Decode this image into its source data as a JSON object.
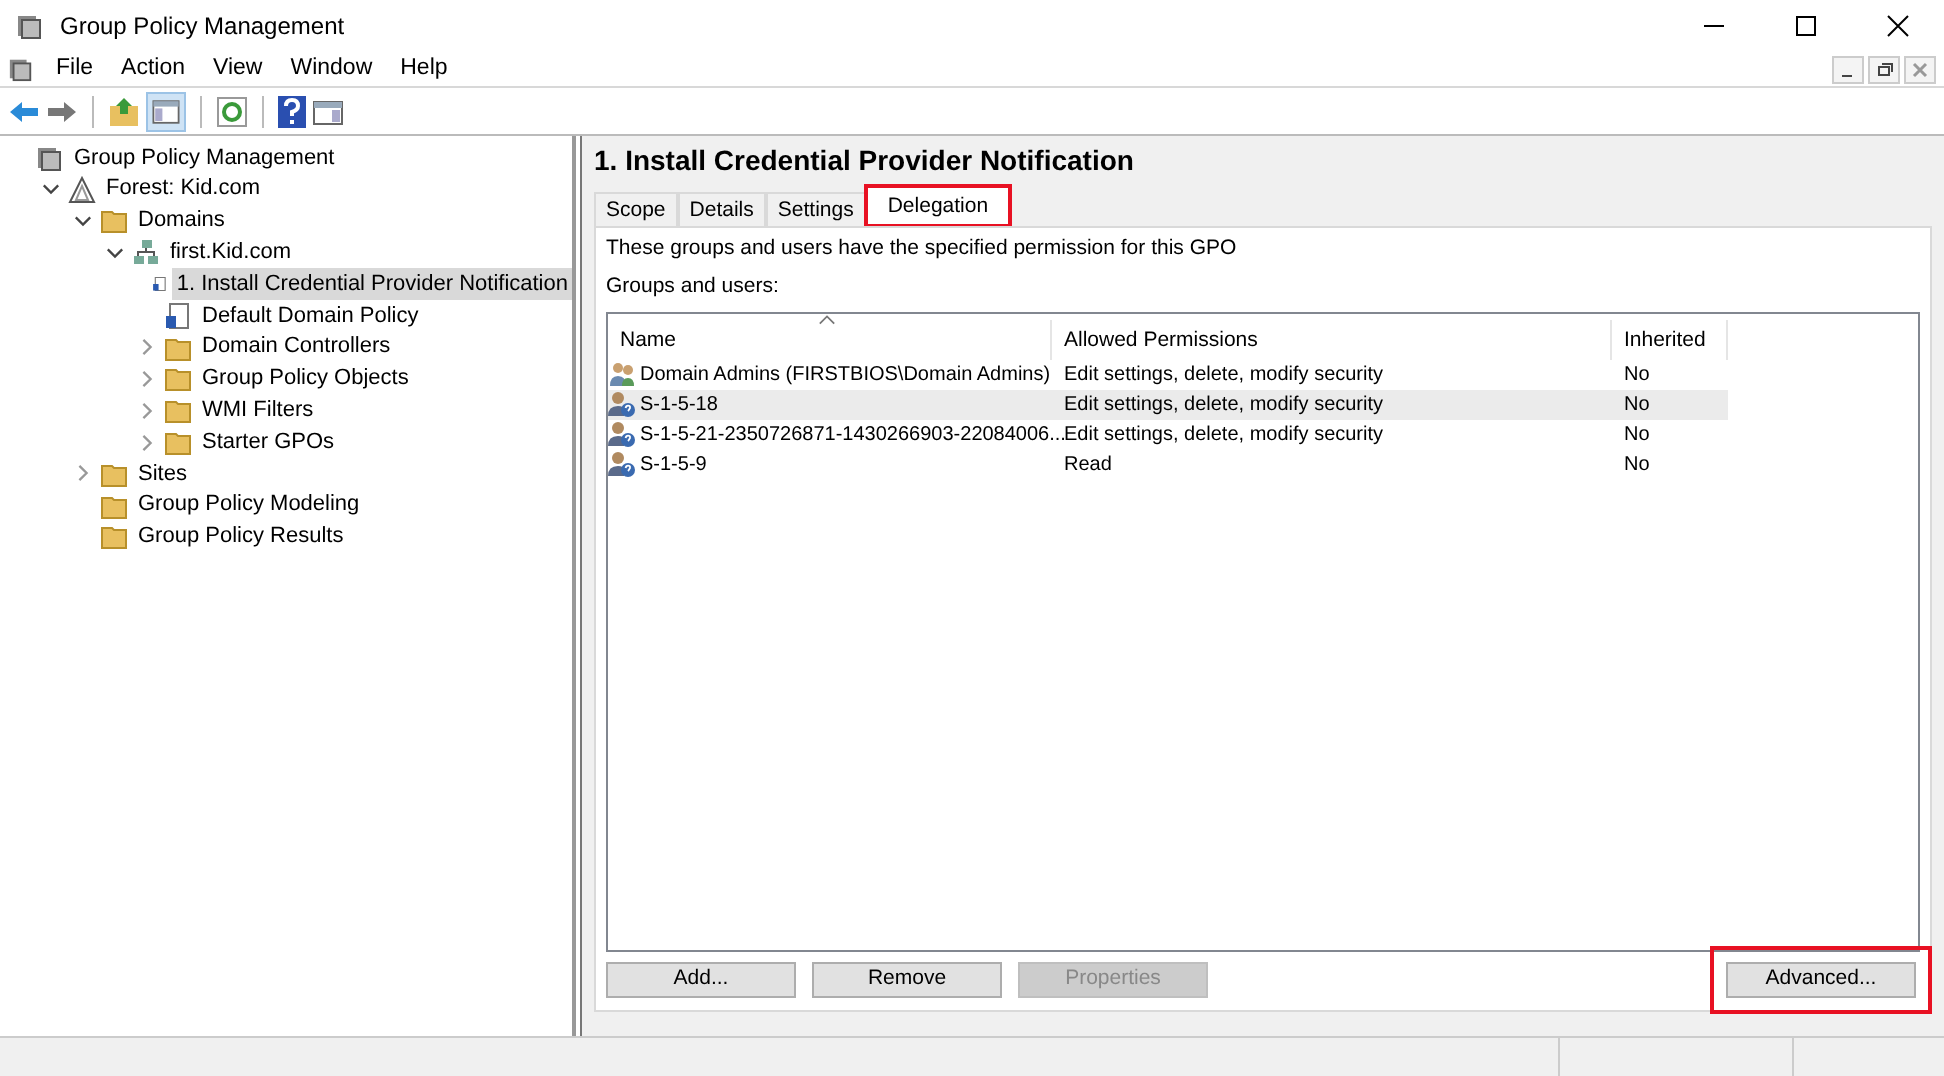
{
  "window": {
    "title": "Group Policy Management"
  },
  "menu": [
    "File",
    "Action",
    "View",
    "Window",
    "Help"
  ],
  "tree": [
    {
      "label": "Group Policy Management",
      "kind": "console",
      "selected": false,
      "children": [
        {
          "label": "Forest: Kid.com",
          "kind": "forest",
          "selected": false,
          "expanded": true,
          "children": [
            {
              "label": "Domains",
              "kind": "folder",
              "selected": false,
              "expanded": true,
              "children": [
                {
                  "label": "first.Kid.com",
                  "kind": "domain",
                  "selected": false,
                  "expanded": true,
                  "children": [
                    {
                      "label": "1. Install Credential Provider Notification",
                      "kind": "gpo",
                      "selected": true
                    },
                    {
                      "label": "Default Domain Policy",
                      "kind": "gpo",
                      "selected": false
                    },
                    {
                      "label": "Domain Controllers",
                      "kind": "folder",
                      "selected": false,
                      "expanded": false
                    },
                    {
                      "label": "Group Policy Objects",
                      "kind": "folder",
                      "selected": false,
                      "expanded": false
                    },
                    {
                      "label": "WMI Filters",
                      "kind": "folder",
                      "selected": false,
                      "expanded": false
                    },
                    {
                      "label": "Starter GPOs",
                      "kind": "folder",
                      "selected": false,
                      "expanded": false
                    }
                  ]
                }
              ]
            },
            {
              "label": "Sites",
              "kind": "folder",
              "selected": false,
              "expanded": false
            },
            {
              "label": "Group Policy Modeling",
              "kind": "folder",
              "selected": false
            },
            {
              "label": "Group Policy Results",
              "kind": "folder",
              "selected": false
            }
          ]
        }
      ]
    }
  ],
  "panel": {
    "title": "1. Install Credential Provider Notification",
    "tabs": [
      {
        "label": "Scope",
        "selected": false,
        "highlighted": false
      },
      {
        "label": "Details",
        "selected": false,
        "highlighted": false
      },
      {
        "label": "Settings",
        "selected": false,
        "highlighted": false
      },
      {
        "label": "Delegation",
        "selected": true,
        "highlighted": true
      }
    ],
    "description": "These groups and users have the specified permission for this GPO",
    "list_label": "Groups and users:",
    "table": {
      "columns": [
        "Name",
        "Allowed Permissions",
        "Inherited"
      ],
      "rows": [
        {
          "kind": "group",
          "selected": false,
          "cells": [
            "Domain Admins (FIRSTBIOS\\Domain Admins)",
            "Edit settings, delete, modify security",
            "No"
          ]
        },
        {
          "kind": "unknown",
          "selected": true,
          "cells": [
            "S-1-5-18",
            "Edit settings, delete, modify security",
            "No"
          ]
        },
        {
          "kind": "unknown",
          "selected": false,
          "cells": [
            "S-1-5-21-2350726871-1430266903-22084006...",
            "Edit settings, delete, modify security",
            "No"
          ]
        },
        {
          "kind": "unknown",
          "selected": false,
          "cells": [
            "S-1-5-9",
            "Read",
            "No"
          ]
        }
      ]
    },
    "buttons": [
      {
        "label": "Add...",
        "disabled": false,
        "highlighted": false
      },
      {
        "label": "Remove",
        "disabled": false,
        "highlighted": false
      },
      {
        "label": "Properties",
        "disabled": true,
        "highlighted": false
      },
      {
        "label": "Advanced...",
        "disabled": false,
        "highlighted": true
      }
    ]
  }
}
